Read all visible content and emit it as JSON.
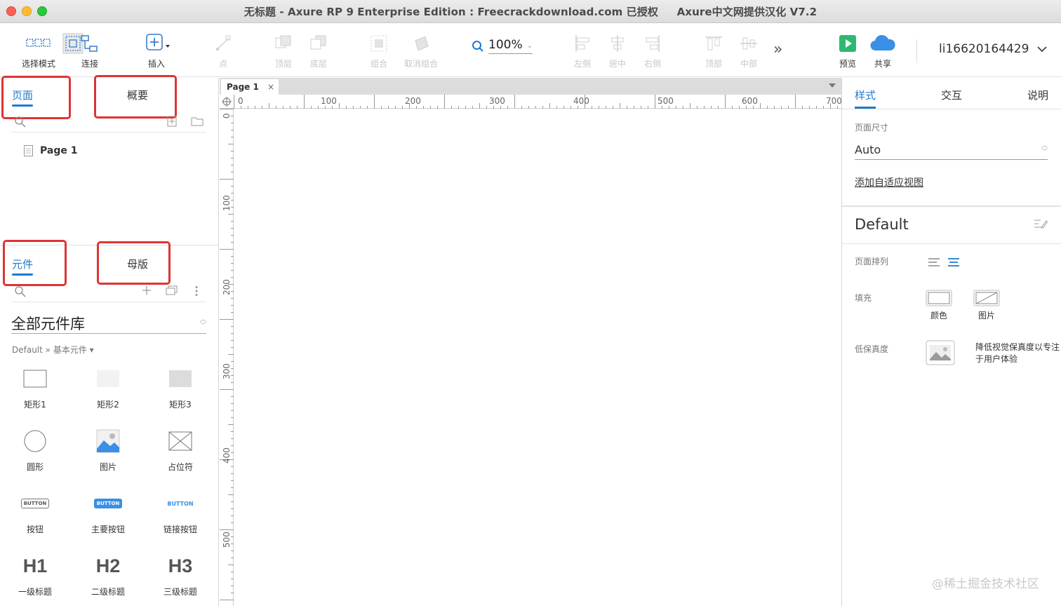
{
  "window": {
    "title": "无标题 - Axure RP 9 Enterprise Edition : Freecrackdownload.com 已授权     Axure中文网提供汉化 V7.2"
  },
  "toolbar": {
    "select_mode": "选择模式",
    "connect": "连接",
    "insert": "插入",
    "point": "点",
    "top_layer": "顶层",
    "bottom_layer": "底层",
    "group": "组合",
    "ungroup": "取消组合",
    "zoom": "100%",
    "align_left": "左侧",
    "align_center": "居中",
    "align_right": "右侧",
    "align_top": "顶部",
    "align_middle": "中部",
    "preview": "预览",
    "share": "共享",
    "username": "li16620164429"
  },
  "left_panel": {
    "tabs": {
      "pages": "页面",
      "outline": "概要"
    },
    "pages": [
      {
        "label": "Page 1"
      }
    ],
    "lib_tabs": {
      "widgets": "元件",
      "masters": "母版"
    },
    "library_select": "全部元件库",
    "library_path": "Default » 基本元件 ▾",
    "widgets": [
      {
        "label": "矩形1"
      },
      {
        "label": "矩形2"
      },
      {
        "label": "矩形3"
      },
      {
        "label": "圆形"
      },
      {
        "label": "图片"
      },
      {
        "label": "占位符"
      },
      {
        "label": "按钮",
        "glyph": "BUTTON"
      },
      {
        "label": "主要按钮",
        "glyph": "BUTTON"
      },
      {
        "label": "链接按钮",
        "glyph": "BUTTON"
      },
      {
        "label": "一级标题",
        "glyph": "H1"
      },
      {
        "label": "二级标题",
        "glyph": "H2"
      },
      {
        "label": "三级标题",
        "glyph": "H3"
      }
    ]
  },
  "canvas": {
    "tab_label": "Page 1",
    "tab_close": "×",
    "ruler_top": [
      "0",
      "100",
      "200",
      "300",
      "400",
      "500",
      "600",
      "700"
    ],
    "ruler_left": [
      "0",
      "100",
      "200",
      "300",
      "400",
      "500"
    ]
  },
  "right_panel": {
    "tabs": {
      "style": "样式",
      "interaction": "交互",
      "notes": "说明"
    },
    "page_size_label": "页面尺寸",
    "page_size_value": "Auto",
    "add_adaptive_view": "添加自适应视图",
    "style_name": "Default",
    "page_align_label": "页面排列",
    "fill_label": "填充",
    "fill_color": "颜色",
    "fill_image": "图片",
    "low_fidelity_label": "低保真度",
    "low_fidelity_desc": "降低视觉保真度以专注于用户体验"
  },
  "watermark": "@稀土掘金技术社区",
  "colors": {
    "accent": "#1f7ad0",
    "highlight_box": "#e03333",
    "preview_green": "#2eb872",
    "share_blue": "#3a8fe6"
  }
}
